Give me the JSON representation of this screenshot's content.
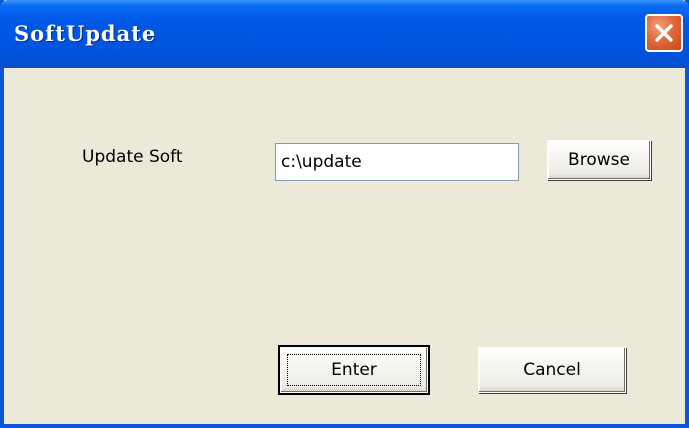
{
  "window": {
    "title": "SoftUpdate",
    "close_icon": "close-x-icon",
    "colors": {
      "titlebar": "#0055e0",
      "body": "#ece9d8",
      "close_button": "#e06a3c"
    }
  },
  "form": {
    "update_label": "Update Soft",
    "path_value": "c:\\update"
  },
  "buttons": {
    "browse": "Browse",
    "enter": "Enter",
    "cancel": "Cancel"
  }
}
